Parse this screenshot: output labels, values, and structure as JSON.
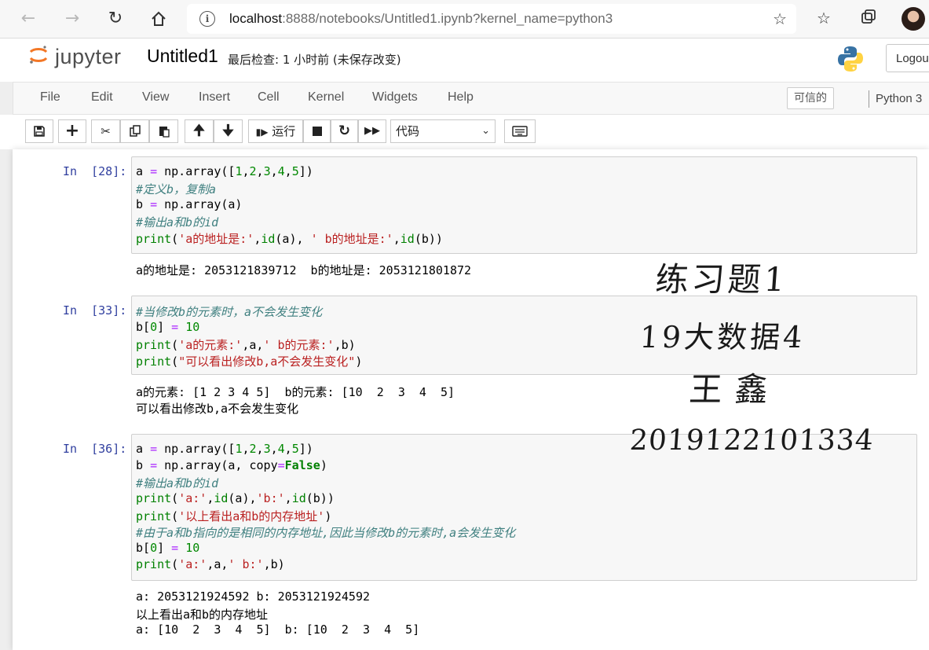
{
  "browser": {
    "url_host": "localhost",
    "url_rest": ":8888/notebooks/Untitled1.ipynb?kernel_name=python3"
  },
  "header": {
    "logo_text": "jupyter",
    "notebook_title": "Untitled1",
    "save_status": "最后检查: 1 小时前  (未保存改变)",
    "logout_label": "Logout"
  },
  "menu": {
    "items": [
      "File",
      "Edit",
      "View",
      "Insert",
      "Cell",
      "Kernel",
      "Widgets",
      "Help"
    ],
    "trusted_label": "可信的",
    "kernel_name": "Python 3"
  },
  "toolbar": {
    "run_label": "运行",
    "cell_type_selected": "代码"
  },
  "cells": [
    {
      "prompt": "In  [28]:",
      "lines": [
        "a = np.array([1,2,3,4,5])",
        "#定义b，复制a",
        "b = np.array(a)",
        "#输出a和b的id",
        "print('a的地址是:',id(a), ' b的地址是:',id(b))"
      ],
      "output": [
        "a的地址是: 2053121839712  b的地址是: 2053121801872"
      ]
    },
    {
      "prompt": "In  [33]:",
      "lines": [
        "#当修改b的元素时，a不会发生变化",
        "b[0] = 10",
        "print('a的元素:',a,' b的元素:',b)",
        "print(\"可以看出修改b,a不会发生变化\")"
      ],
      "output": [
        "a的元素: [1 2 3 4 5]  b的元素: [10  2  3  4  5]",
        "可以看出修改b,a不会发生变化"
      ]
    },
    {
      "prompt": "In  [36]:",
      "lines": [
        "a = np.array([1,2,3,4,5])",
        "b = np.array(a, copy=False)",
        "#输出a和b的id",
        "print('a:',id(a),'b:',id(b))",
        "print('以上看出a和b的内存地址')",
        "#由于a和b指向的是相同的内存地址,因此当修改b的元素时,a会发生变化",
        "b[0] = 10",
        "print('a:',a,' b:',b)"
      ],
      "output": [
        "a: 2053121924592 b: 2053121924592",
        "以上看出a和b的内存地址",
        "a: [10  2  3  4  5]  b: [10  2  3  4  5]"
      ]
    }
  ],
  "handwriting": {
    "line1": "练习题1",
    "line2": "19大数据4",
    "line3": "王鑫",
    "line4": "2019122101334"
  }
}
